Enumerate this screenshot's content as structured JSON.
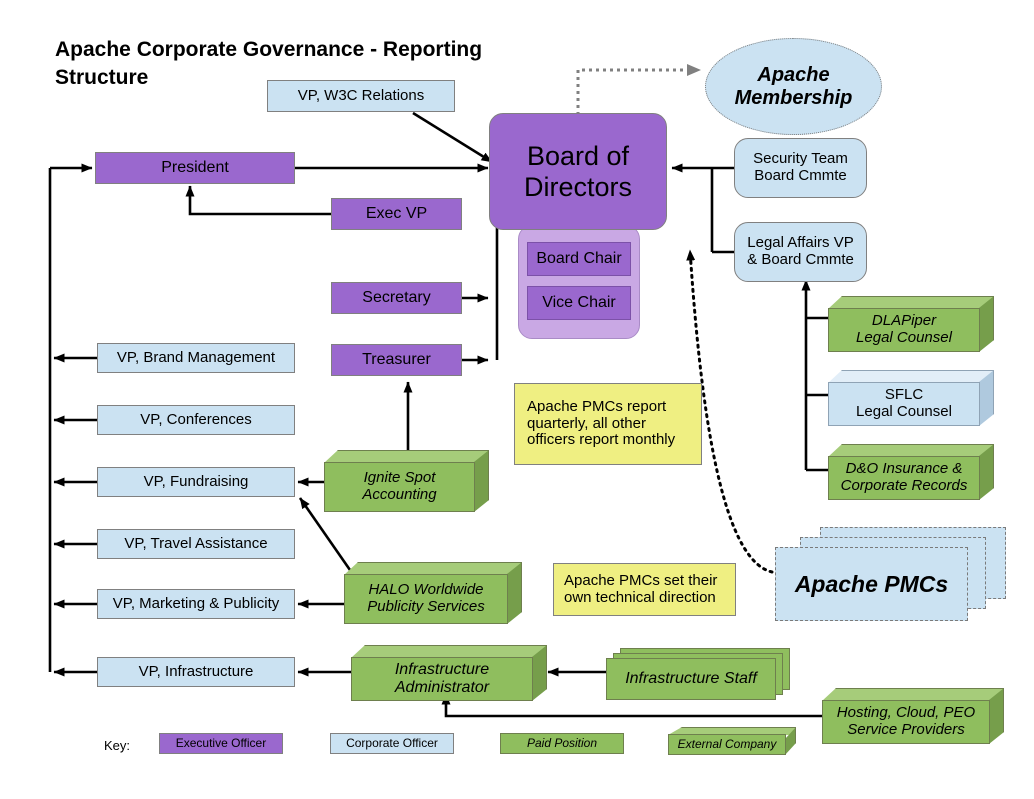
{
  "title": "Apache Corporate Governance - Reporting Structure",
  "nodes": {
    "board": "Board of Directors",
    "board_chair": "Board Chair",
    "vice_chair": "Vice Chair",
    "president": "President",
    "exec_vp": "Exec VP",
    "secretary": "Secretary",
    "treasurer": "Treasurer",
    "vp_w3c": "VP, W3C Relations",
    "vp_brand": "VP, Brand Management",
    "vp_conferences": "VP, Conferences",
    "vp_fundraising": "VP, Fundraising",
    "vp_travel": "VP, Travel Assistance",
    "vp_marketing": "VP, Marketing & Publicity",
    "vp_infrastructure": "VP, Infrastructure",
    "apache_membership": "Apache Membership",
    "security_team": "Security Team Board Cmmte",
    "security_team_l1": "Security Team",
    "security_team_l2": "Board Cmmte",
    "legal_affairs": "Legal Affairs VP & Board Cmmte",
    "legal_affairs_l1": "Legal Affairs VP",
    "legal_affairs_l2": "& Board Cmmte",
    "dlapiper_l1": "DLAPiper",
    "dlapiper_l2": "Legal Counsel",
    "sflc_l1": "SFLC",
    "sflc_l2": "Legal Counsel",
    "do_insurance_l1": "D&O Insurance &",
    "do_insurance_l2": "Corporate Records",
    "ignite_l1": "Ignite Spot",
    "ignite_l2": "Accounting",
    "halo_l1": "HALO Worldwide",
    "halo_l2": "Publicity Services",
    "infra_admin_l1": "Infrastructure",
    "infra_admin_l2": "Administrator",
    "infra_staff": "Infrastructure Staff",
    "hosting_l1": "Hosting, Cloud, PEO",
    "hosting_l2": "Service Providers",
    "apache_pmcs": "Apache PMCs"
  },
  "notes": {
    "reporting_l1": "Apache PMCs report",
    "reporting_l2": "quarterly, all other",
    "reporting_l3": "officers report monthly",
    "technical_l1": "Apache PMCs set their",
    "technical_l2": "own technical direction"
  },
  "key": {
    "label": "Key:",
    "items": [
      {
        "label": "Executive Officer",
        "type": "purple"
      },
      {
        "label": "Corporate Officer",
        "type": "blue"
      },
      {
        "label": "Paid Position",
        "type": "green-flat"
      },
      {
        "label": "External Company",
        "type": "green-cube"
      }
    ]
  },
  "colors": {
    "executive_officer": "#9A68CE",
    "corporate_officer": "#CBE2F2",
    "paid_position": "#8FBE5E",
    "external_company": "#8FBE5E",
    "note": "#EFEF82",
    "board_container": "#C9A8E4",
    "line": "#000000",
    "dotted_line": "#808080"
  }
}
